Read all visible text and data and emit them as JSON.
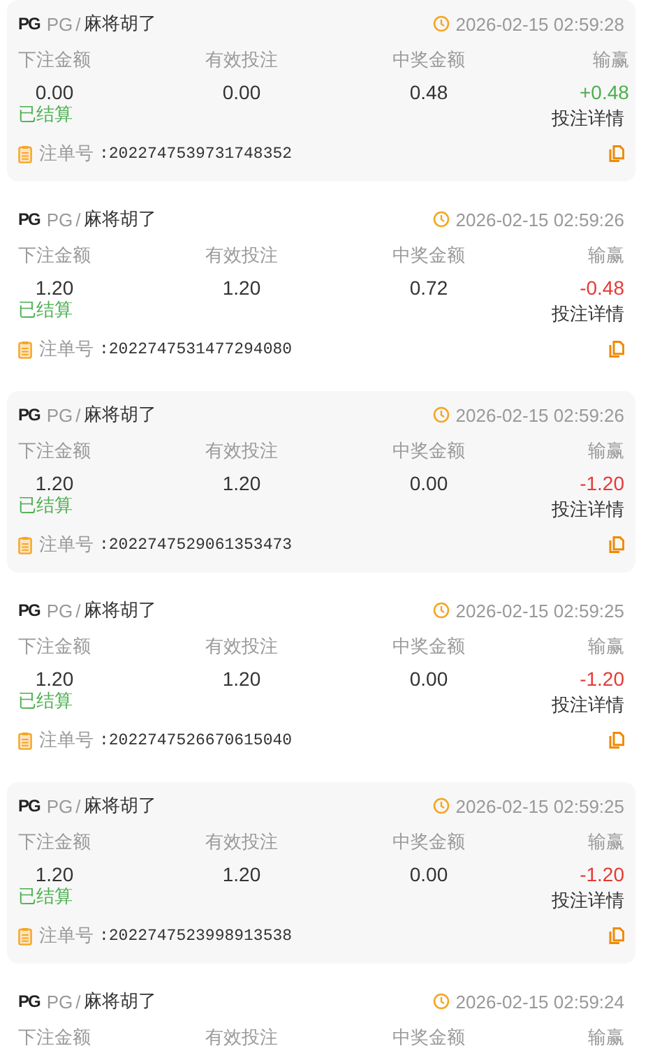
{
  "bets": [
    {
      "logo": "PG",
      "provider": "PG",
      "separator": "/",
      "game": "麻将胡了",
      "time": "2026-02-15 02:59:28",
      "labels": [
        "下注金额",
        "有效投注",
        "中奖金额",
        "输赢"
      ],
      "bet": "0.00",
      "valid": "0.00",
      "payout": "0.48",
      "result": "+0.48",
      "won": true,
      "status": "已结算",
      "details": "投注详情",
      "order_label": "注单号",
      "order_no": ":2022747539731748352"
    },
    {
      "logo": "PG",
      "provider": "PG",
      "separator": "/",
      "game": "麻将胡了",
      "time": "2026-02-15 02:59:26",
      "labels": [
        "下注金额",
        "有效投注",
        "中奖金额",
        "输赢"
      ],
      "bet": "1.20",
      "valid": "1.20",
      "payout": "0.72",
      "result": "-0.48",
      "won": false,
      "status": "已结算",
      "details": "投注详情",
      "order_label": "注单号",
      "order_no": ":2022747531477294080"
    },
    {
      "logo": "PG",
      "provider": "PG",
      "separator": "/",
      "game": "麻将胡了",
      "time": "2026-02-15 02:59:26",
      "labels": [
        "下注金额",
        "有效投注",
        "中奖金额",
        "输赢"
      ],
      "bet": "1.20",
      "valid": "1.20",
      "payout": "0.00",
      "result": "-1.20",
      "won": false,
      "status": "已结算",
      "details": "投注详情",
      "order_label": "注单号",
      "order_no": ":2022747529061353473"
    },
    {
      "logo": "PG",
      "provider": "PG",
      "separator": "/",
      "game": "麻将胡了",
      "time": "2026-02-15 02:59:25",
      "labels": [
        "下注金额",
        "有效投注",
        "中奖金额",
        "输赢"
      ],
      "bet": "1.20",
      "valid": "1.20",
      "payout": "0.00",
      "result": "-1.20",
      "won": false,
      "status": "已结算",
      "details": "投注详情",
      "order_label": "注单号",
      "order_no": ":2022747526670615040"
    },
    {
      "logo": "PG",
      "provider": "PG",
      "separator": "/",
      "game": "麻将胡了",
      "time": "2026-02-15 02:59:25",
      "labels": [
        "下注金额",
        "有效投注",
        "中奖金额",
        "输赢"
      ],
      "bet": "1.20",
      "valid": "1.20",
      "payout": "0.00",
      "result": "-1.20",
      "won": false,
      "status": "已结算",
      "details": "投注详情",
      "order_label": "注单号",
      "order_no": ":2022747523998913538"
    },
    {
      "logo": "PG",
      "provider": "PG",
      "separator": "/",
      "game": "麻将胡了",
      "time": "2026-02-15 02:59:24",
      "labels": [
        "下注金额",
        "有效投注",
        "中奖金额",
        "输赢"
      ]
    }
  ]
}
